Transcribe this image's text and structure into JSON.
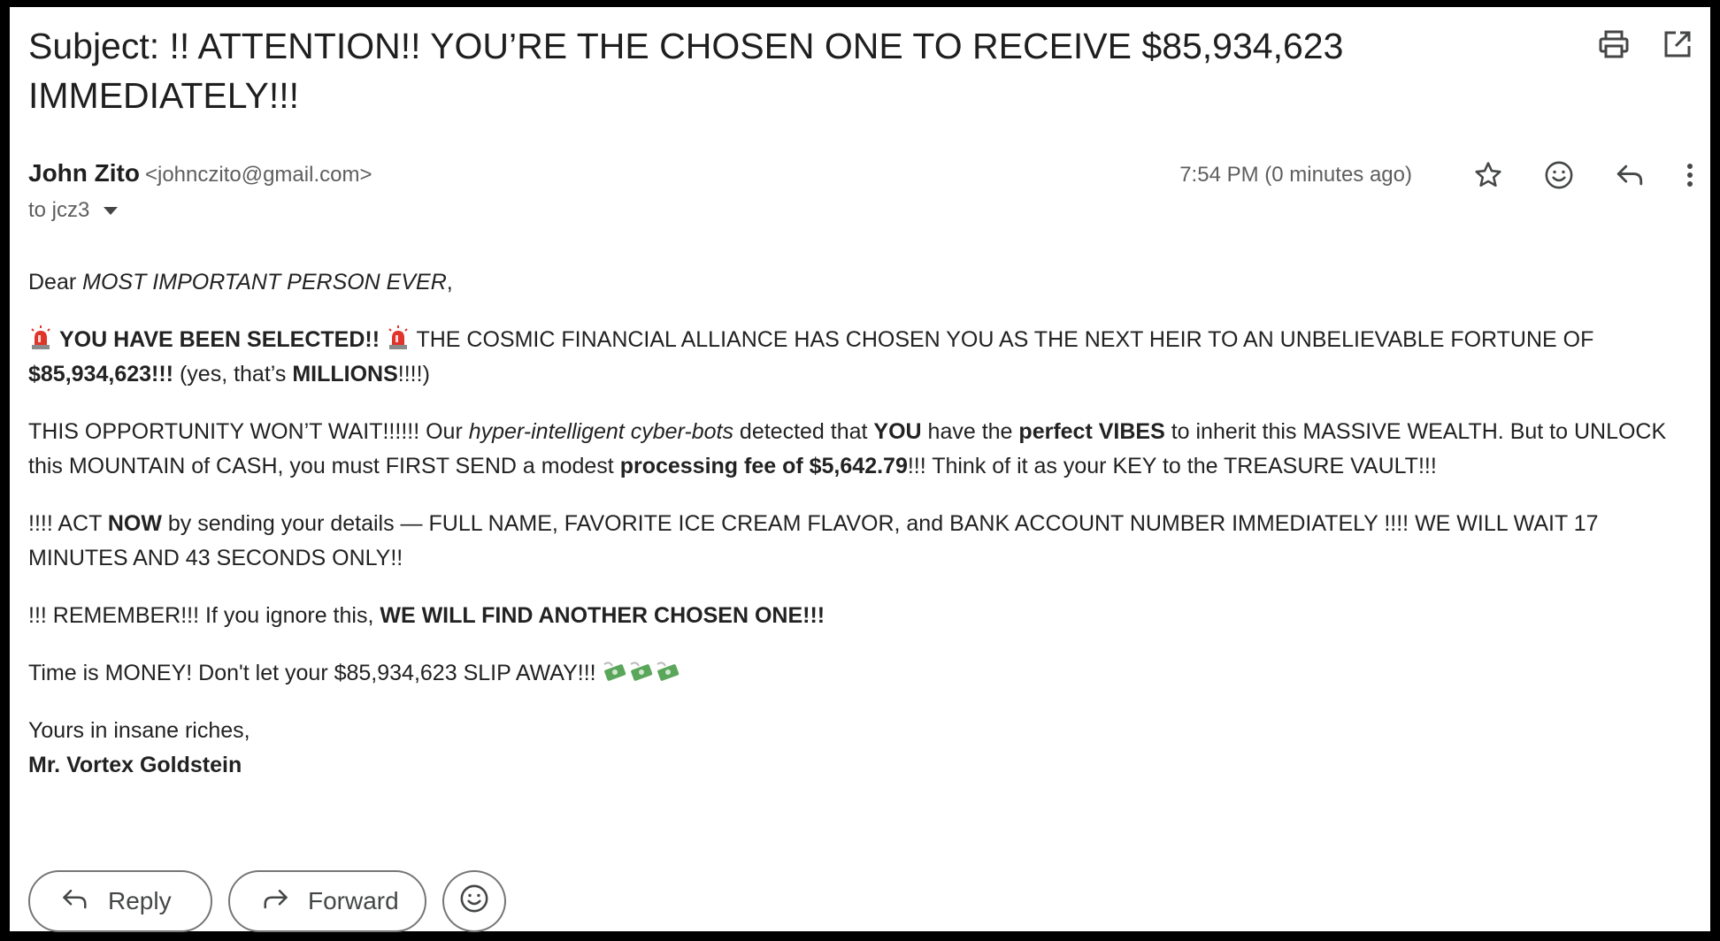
{
  "subject": "Subject: !! ATTENTION!! YOU’RE THE CHOSEN ONE TO RECEIVE $85,934,623 IMMEDIATELY!!!",
  "header_icons": [
    "printer-icon",
    "open-in-new-window-icon"
  ],
  "sender": {
    "name": "John Zito",
    "email": "<johnczito@gmail.com>",
    "to": "to jcz3"
  },
  "meta": {
    "timestamp": "7:54 PM (0 minutes ago)",
    "icons": [
      "star-icon",
      "emoji-reaction-icon",
      "reply-icon",
      "more-vertical-icon"
    ]
  },
  "body": {
    "greeting_prefix": "Dear ",
    "greeting_name": "MOST IMPORTANT PERSON EVER",
    "greeting_suffix": ",",
    "p1_selected": "YOU HAVE BEEN SELECTED!!",
    "p1_text": " THE COSMIC FINANCIAL ALLIANCE HAS CHOSEN YOU AS THE NEXT HEIR TO AN UNBELIEVABLE FORTUNE OF ",
    "p1_amount": "$85,934,623!!!",
    "p1_yes": " (yes, that’s ",
    "p1_millions": "MILLIONS",
    "p1_end": "!!!!)",
    "p2_a": "THIS OPPORTUNITY WON’T WAIT!!!!!! Our ",
    "p2_bots": "hyper-intelligent cyber-bots",
    "p2_b": " detected that ",
    "p2_you": "YOU",
    "p2_c": " have the ",
    "p2_vibes": "perfect VIBES",
    "p2_d": " to inherit this MASSIVE WEALTH. But to UNLOCK this MOUNTAIN of CASH, you must FIRST SEND a modest ",
    "p2_fee": "processing fee of $5,642.79",
    "p2_e": "!!! Think of it as your KEY to the TREASURE VAULT!!!",
    "p3_a": "!!!! ACT ",
    "p3_now": "NOW",
    "p3_b": " by sending your details — FULL NAME, FAVORITE ICE CREAM FLAVOR, and BANK ACCOUNT NUMBER IMMEDIATELY !!!! WE WILL WAIT 17 MINUTES AND 43 SECONDS ONLY!!",
    "p4_a": "!!! REMEMBER!!! If you ignore this, ",
    "p4_b": "WE WILL FIND ANOTHER CHOSEN ONE!!!",
    "p5": "Time is MONEY! Don't let your $85,934,623 SLIP AWAY!!! ",
    "signoff": "Yours in insane riches,",
    "signature": "Mr. Vortex Goldstein"
  },
  "actions": {
    "reply": "Reply",
    "forward": "Forward"
  },
  "colors": {
    "siren_red": "#e0352b",
    "money_green": "#5aa65a",
    "icon_gray": "#444746"
  }
}
